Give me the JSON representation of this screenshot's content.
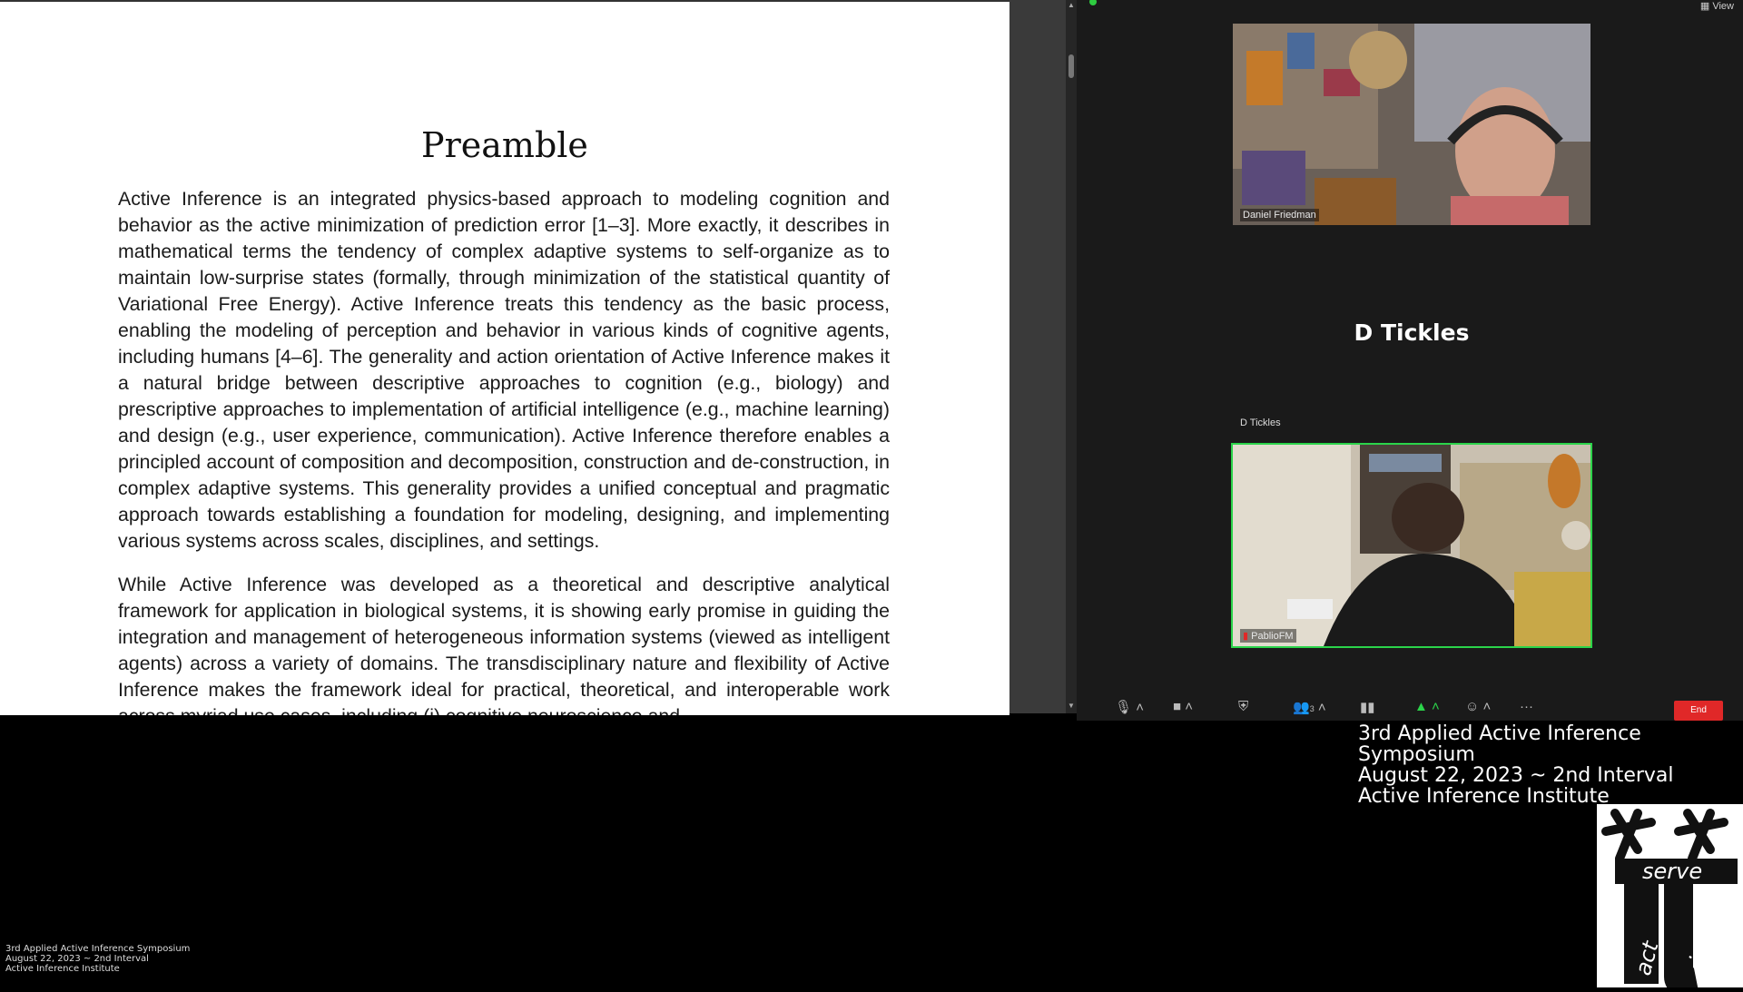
{
  "document": {
    "title": "Preamble",
    "paragraphs": [
      "Active Inference is an integrated physics-based approach to modeling cognition and behavior as the active minimization of prediction error [1–3]. More exactly, it describes in mathematical terms the tendency of complex adaptive systems to self-organize as to maintain low-surprise states (formally, through minimization of the statistical quantity of Variational Free Energy). Active Inference treats this tendency as the basic process, enabling the modeling of perception and behavior in various kinds of cognitive agents, including humans [4–6]. The generality and action orientation of Active Inference makes it a natural bridge between descriptive approaches to cognition (e.g., biology) and prescriptive approaches to implementation of artificial intelligence (e.g., machine learning) and design (e.g., user experience, communication). Active Inference therefore enables a principled account of composition and decomposition, construction and de-construction, in complex adaptive systems. This generality provides a unified conceptual and pragmatic approach towards establishing a foundation for modeling, designing, and implementing various systems across scales, disciplines, and settings.",
      "While Active Inference was developed as a theoretical and descriptive analytical framework for application in biological systems, it is showing early promise in guiding the integration and management of heterogeneous information systems (viewed as intelligent agents) across a variety of domains. The transdisciplinary nature and flexibility of Active Inference makes the framework ideal for practical, theoretical, and interoperable work across myriad use cases, including (i) cognitive neuroscience and"
    ]
  },
  "zoom": {
    "view_label": "View",
    "participants": [
      {
        "name": "Daniel Friedman"
      },
      {
        "name": "D Tickles",
        "display": "D Tickles"
      },
      {
        "name": "PablioFM"
      }
    ],
    "participant_count": "3",
    "end_label": "End",
    "colors": {
      "active_speaker": "#2bd44a",
      "end_button": "#e02828",
      "share": "#2bd44a"
    }
  },
  "overlay": {
    "line1": "3rd Applied Active Inference Symposium",
    "line2": "August 22, 2023 ~ 2nd Interval",
    "line3": "Active Inference Institute"
  },
  "caption": {
    "line1": "3rd Applied Active Inference Symposium",
    "line2": "August 22, 2023 ~ 2nd Interval",
    "line3": "Active Inference Institute"
  },
  "logo": {
    "word1": "serve",
    "word2": "act",
    "word3": "infer"
  }
}
